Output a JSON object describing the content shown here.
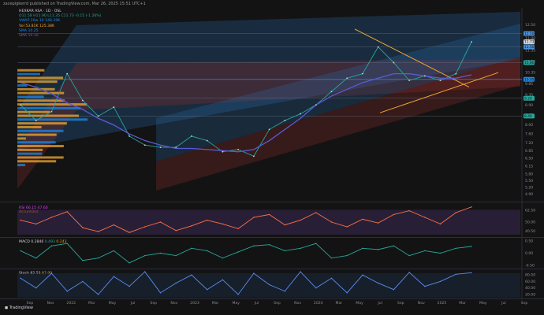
{
  "header": {
    "publisher_line": "zacepigkerrd published on TradingView.com, Mar 26, 2025 15:51 UTC+1"
  },
  "legend": {
    "symbol_line": "HEXKAR ASA · 1D · OSL",
    "ohlc": "O11.58 H11.90 L11.35 C11.73 -0.15 (-1.26%)",
    "vwap": "VWAP  20w 10",
    "vwap_value": "148.39K",
    "vol": "Vol  53.81K  125.38K",
    "sma1": "SMA  10.25",
    "sma2": "SMA  10.10"
  },
  "rsi_legend": {
    "a": "RSI  66.15  47.60",
    "b": "AccumDist"
  },
  "macd_legend": {
    "a": "MACD  0.2846",
    "b": "0.493",
    "c": "0.243"
  },
  "stoch_legend": {
    "a": "Stoch  82.53",
    "b": "87.00"
  },
  "footer": {
    "brand": "TradingView"
  },
  "colors": {
    "background": "#131313",
    "blue_channel": "#2a6fb4",
    "red_channel": "#8b2a2a",
    "sma_blue": "#5b5bd6",
    "trend_orange": "#f0a830",
    "rsi_band": "#3b2a55",
    "price_line": "#26a69a"
  },
  "chart_data": [
    {
      "type": "line",
      "title": "",
      "x_ticks": [
        "Sep",
        "Nov",
        "2022",
        "Mar",
        "May",
        "Jul",
        "Sep",
        "Nov",
        "2023",
        "Mar",
        "May",
        "Jul",
        "Sep",
        "Nov",
        "2024",
        "Mar",
        "May",
        "Jul",
        "Sep",
        "Nov",
        "2025",
        "Mar",
        "May",
        "Jul",
        "Sep"
      ],
      "y_ticks": [
        4.9,
        5.2,
        5.5,
        5.8,
        6.15,
        6.5,
        6.85,
        7.2,
        7.6,
        8.0,
        8.45,
        8.9,
        9.35,
        9.85,
        10.35,
        10.85,
        11.35,
        11.9,
        12.5
      ],
      "price_labels": [
        {
          "text": "12.10",
          "color": "#4a90d9"
        },
        {
          "text": "11.50",
          "color": "#4a90d9"
        },
        {
          "text": "11.73",
          "color": "#d1d4dc"
        },
        {
          "text": "10.80",
          "color": "#26a69a"
        },
        {
          "text": "10.05",
          "color": "#1e88e5"
        },
        {
          "text": "9.20",
          "color": "#26a69a"
        },
        {
          "text": "8.40",
          "color": "#26a69a"
        }
      ],
      "series": [
        {
          "name": "Close",
          "values": [
            8.9,
            8.2,
            8.6,
            10.3,
            9.1,
            8.4,
            8.8,
            7.5,
            7.1,
            7.0,
            7.0,
            7.5,
            7.3,
            6.8,
            6.9,
            6.6,
            7.8,
            8.2,
            8.5,
            8.9,
            9.5,
            10.1,
            10.3,
            11.5,
            10.8,
            10.0,
            10.2,
            10.0,
            10.3,
            11.73
          ]
        },
        {
          "name": "SMA",
          "values": [
            9.9,
            9.7,
            9.4,
            9.0,
            8.7,
            8.3,
            8.0,
            7.6,
            7.3,
            7.1,
            6.95,
            6.95,
            6.9,
            6.85,
            6.8,
            6.9,
            7.3,
            7.8,
            8.3,
            8.9,
            9.3,
            9.6,
            9.9,
            10.1,
            10.3,
            10.3,
            10.2,
            10.1,
            10.1,
            10.25
          ]
        }
      ]
    },
    {
      "type": "line",
      "title": "",
      "y_ticks": [
        62.5,
        50,
        40.5
      ],
      "series": [
        {
          "name": "RSI",
          "values": [
            52,
            48,
            55,
            61,
            44,
            40,
            47,
            39,
            45,
            50,
            41,
            46,
            52,
            48,
            43,
            55,
            58,
            47,
            52,
            60,
            50,
            45,
            53,
            49,
            58,
            62,
            55,
            48,
            60,
            66
          ]
        }
      ]
    },
    {
      "type": "line",
      "title": "",
      "y_ticks": [
        0.5,
        0.0,
        -0.5
      ],
      "series": [
        {
          "name": "MACD",
          "values": [
            0.1,
            -0.2,
            0.3,
            0.4,
            -0.3,
            -0.2,
            0.1,
            -0.4,
            -0.1,
            0.0,
            -0.1,
            0.2,
            0.1,
            -0.2,
            0.05,
            0.3,
            0.35,
            0.1,
            0.2,
            0.4,
            -0.2,
            -0.1,
            0.2,
            0.15,
            0.3,
            -0.1,
            0.1,
            0.0,
            0.2,
            0.28
          ]
        }
      ]
    },
    {
      "type": "line",
      "title": "",
      "y_ticks": [
        80,
        60,
        40,
        20
      ],
      "series": [
        {
          "name": "Stoch",
          "values": [
            70,
            40,
            85,
            30,
            60,
            20,
            75,
            45,
            90,
            25,
            55,
            80,
            35,
            65,
            20,
            85,
            50,
            30,
            90,
            40,
            70,
            25,
            80,
            55,
            35,
            88,
            45,
            60,
            82,
            87
          ]
        }
      ]
    }
  ]
}
